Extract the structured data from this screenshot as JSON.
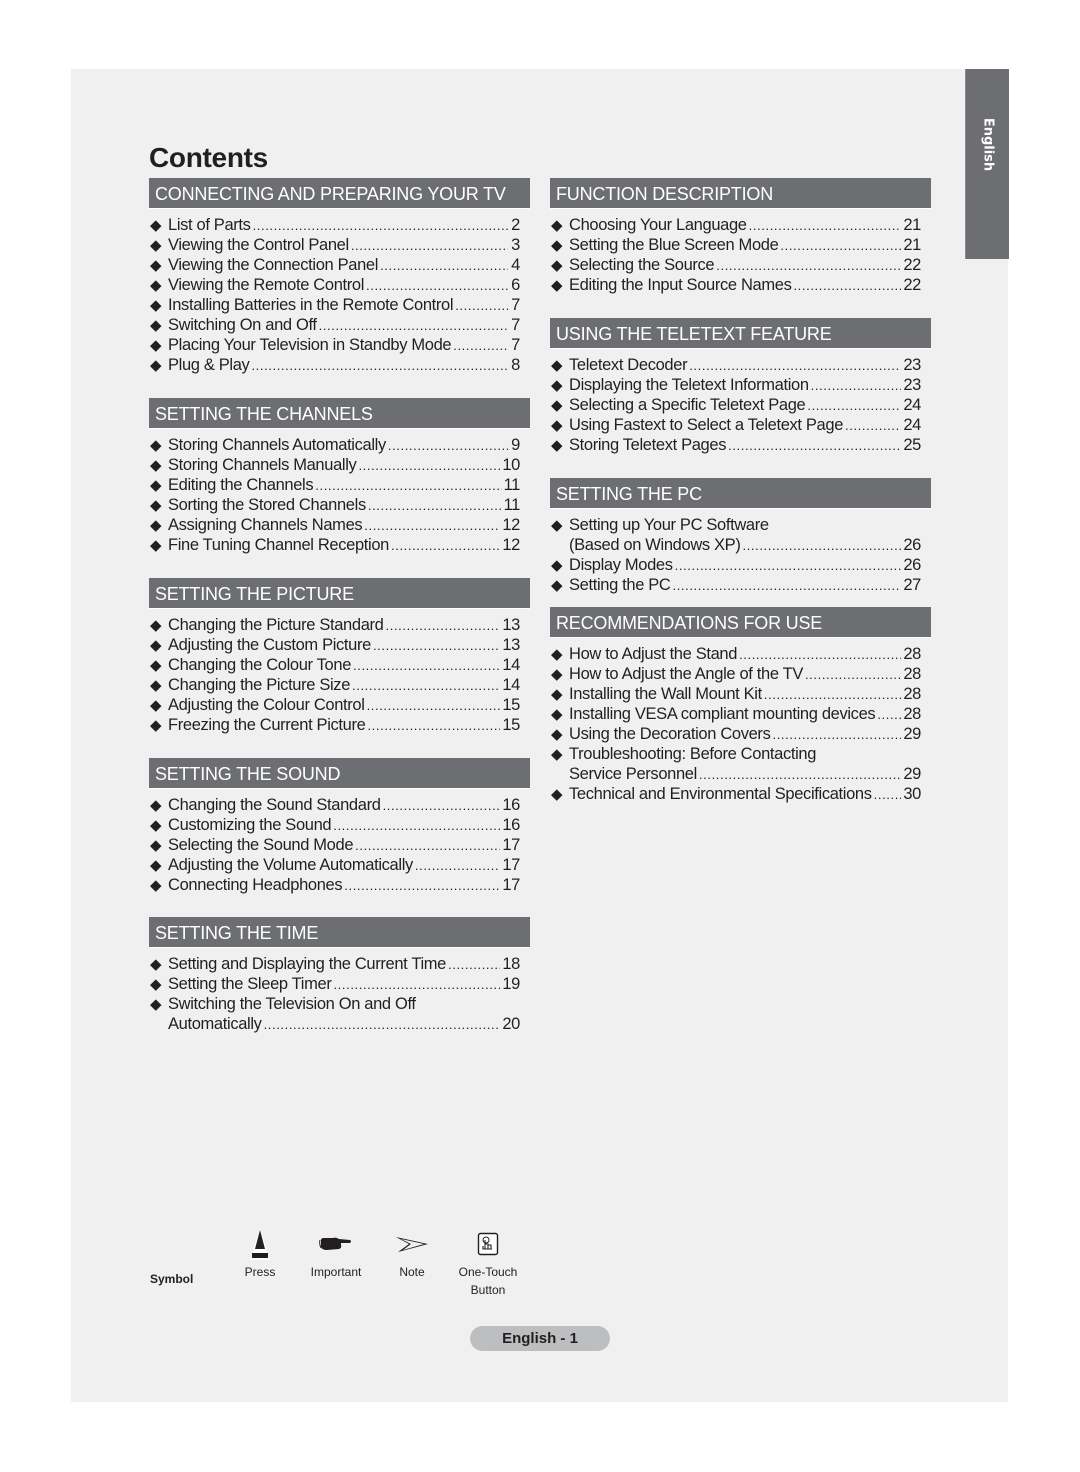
{
  "page_title": "Contents",
  "language_tab": "English",
  "left_column": [
    {
      "header": "CONNECTING AND PREPARING YOUR TV",
      "entries": [
        {
          "label": "List of Parts",
          "page": "2"
        },
        {
          "label": "Viewing the Control Panel",
          "page": "3"
        },
        {
          "label": "Viewing the Connection Panel",
          "page": "4"
        },
        {
          "label": "Viewing the Remote Control",
          "page": "6"
        },
        {
          "label": "Installing Batteries in the Remote Control",
          "page": "7"
        },
        {
          "label": "Switching On and Off",
          "page": "7"
        },
        {
          "label": "Placing Your Television in Standby Mode",
          "page": "7"
        },
        {
          "label": "Plug & Play",
          "page": "8"
        }
      ]
    },
    {
      "header": "SETTING THE CHANNELS",
      "entries": [
        {
          "label": "Storing Channels Automatically",
          "page": "9"
        },
        {
          "label": "Storing Channels Manually",
          "page": "10"
        },
        {
          "label": "Editing the Channels",
          "page": "11"
        },
        {
          "label": "Sorting the Stored Channels",
          "page": "11"
        },
        {
          "label": "Assigning Channels Names",
          "page": "12"
        },
        {
          "label": "Fine Tuning Channel Reception",
          "page": "12"
        }
      ]
    },
    {
      "header": "SETTING THE PICTURE",
      "entries": [
        {
          "label": "Changing the Picture Standard",
          "page": "13"
        },
        {
          "label": "Adjusting the Custom Picture",
          "page": "13"
        },
        {
          "label": "Changing the Colour Tone",
          "page": "14"
        },
        {
          "label": "Changing the Picture Size",
          "page": "14"
        },
        {
          "label": "Adjusting the Colour Control",
          "page": "15"
        },
        {
          "label": "Freezing the Current Picture",
          "page": "15"
        }
      ]
    },
    {
      "header": "SETTING THE SOUND",
      "entries": [
        {
          "label": "Changing the Sound Standard",
          "page": "16"
        },
        {
          "label": "Customizing the Sound",
          "page": "16"
        },
        {
          "label": "Selecting the Sound Mode",
          "page": "17"
        },
        {
          "label": "Adjusting the Volume Automatically",
          "page": "17"
        },
        {
          "label": "Connecting Headphones",
          "page": "17"
        }
      ]
    },
    {
      "header": "SETTING THE TIME",
      "entries": [
        {
          "label": "Setting and Displaying the Current Time",
          "page": "18"
        },
        {
          "label": "Setting the Sleep Timer",
          "page": "19"
        },
        {
          "label": "Switching the Television On and Off",
          "continuation": "Automatically",
          "page": "20"
        }
      ]
    }
  ],
  "right_column": [
    {
      "header": "FUNCTION DESCRIPTION",
      "entries": [
        {
          "label": "Choosing Your Language",
          "page": "21"
        },
        {
          "label": "Setting the Blue Screen Mode",
          "page": "21"
        },
        {
          "label": "Selecting the Source",
          "page": "22"
        },
        {
          "label": "Editing the Input Source Names",
          "page": "22"
        }
      ]
    },
    {
      "header": "USING THE TELETEXT FEATURE",
      "entries": [
        {
          "label": "Teletext Decoder",
          "page": "23"
        },
        {
          "label": "Displaying the Teletext Information",
          "page": "23"
        },
        {
          "label": "Selecting a Specific Teletext Page",
          "page": "24"
        },
        {
          "label": "Using Fastext to Select a Teletext Page",
          "page": "24"
        },
        {
          "label": "Storing Teletext Pages",
          "page": "25"
        }
      ]
    },
    {
      "header": "SETTING THE PC",
      "entries": [
        {
          "label": "Setting up Your PC Software",
          "continuation": "(Based on Windows XP)",
          "page": "26"
        },
        {
          "label": "Display Modes",
          "page": "26"
        },
        {
          "label": "Setting the PC",
          "page": "27"
        }
      ]
    },
    {
      "header": "RECOMMENDATIONS FOR USE",
      "entries": [
        {
          "label": "How to Adjust the Stand",
          "page": "28"
        },
        {
          "label": "How to Adjust the Angle of the TV",
          "page": "28"
        },
        {
          "label": "Installing the Wall Mount Kit",
          "page": "28"
        },
        {
          "label": "Installing VESA compliant mounting devices",
          "page": "28"
        },
        {
          "label": "Using the Decoration Covers",
          "page": "29"
        },
        {
          "label": "Troubleshooting: Before Contacting",
          "continuation": "Service Personnel",
          "page": "29"
        },
        {
          "label": "Technical and Environmental Specifications",
          "page": "30"
        }
      ]
    }
  ],
  "legend": {
    "title": "Symbol",
    "items": [
      {
        "icon": "press-icon",
        "label": "Press"
      },
      {
        "icon": "pointing-hand-icon",
        "label": "Important"
      },
      {
        "icon": "arrow-note-icon",
        "label": "Note"
      },
      {
        "icon": "one-touch-button-icon",
        "label": "One-Touch",
        "label2": "Button"
      }
    ]
  },
  "footer": "English - 1",
  "colors": {
    "page_background": "#eff0ef",
    "header_background": "#6d6e71",
    "header_text": "#ffffff",
    "body_text": "#231f20",
    "footer_pill": "#bdbec0"
  }
}
